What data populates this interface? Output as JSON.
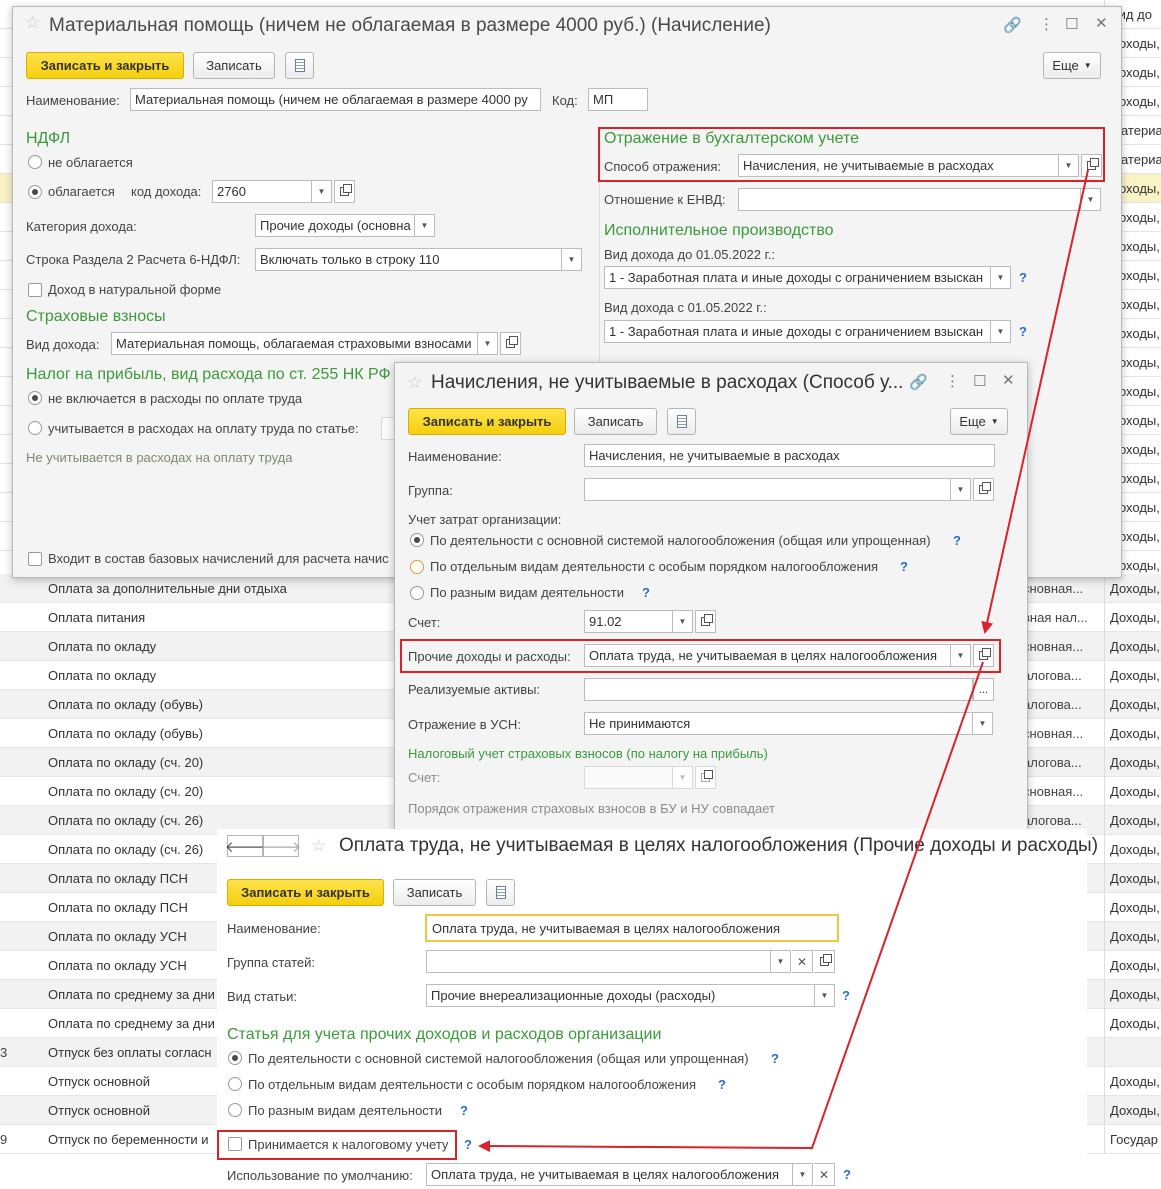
{
  "bg_list": {
    "top_rows": [
      {
        "right": "Вид до"
      },
      {
        "right": "Доходы,"
      },
      {
        "right": "Доходы,"
      },
      {
        "right": "Доходы,"
      },
      {
        "right": "Материа"
      },
      {
        "right": "Материа"
      },
      {
        "right": "Доходы,"
      },
      {
        "right": "Доходы,"
      },
      {
        "right": "Доходы,"
      },
      {
        "right": "Доходы,"
      },
      {
        "right": "Доходы,"
      },
      {
        "right": "Доходы,"
      },
      {
        "right": "Доходы,"
      },
      {
        "right": "Доходы,"
      },
      {
        "right": "Доходы,"
      },
      {
        "right": "Доходы,"
      },
      {
        "right": "Доходы,"
      },
      {
        "right": "Доходы,"
      },
      {
        "right": "Доходы,"
      },
      {
        "right": "Доходы,"
      }
    ],
    "rows": [
      {
        "num": "",
        "name": "Оплата за дополнительные дни отдыха",
        "mid": "сновная...",
        "right": "Доходы,"
      },
      {
        "num": "",
        "name": "Оплата питания",
        "mid": "вная нал...",
        "right": "Доходы,"
      },
      {
        "num": "",
        "name": "Оплата по окладу",
        "mid": "сновная...",
        "right": "Доходы,"
      },
      {
        "num": "",
        "name": "Оплата по окладу",
        "mid": "алогова...",
        "right": "Доходы,"
      },
      {
        "num": "",
        "name": "Оплата по окладу (обувь)",
        "mid": "алогова...",
        "right": "Доходы,"
      },
      {
        "num": "",
        "name": "Оплата по окладу (обувь)",
        "mid": "сновная...",
        "right": "Доходы,"
      },
      {
        "num": "",
        "name": "Оплата по окладу (сч. 20)",
        "mid": "алогова...",
        "right": "Доходы,"
      },
      {
        "num": "",
        "name": "Оплата по окладу (сч. 20)",
        "mid": "сновная...",
        "right": "Доходы,"
      },
      {
        "num": "",
        "name": "Оплата по окладу (сч. 26)",
        "mid": "алогова...",
        "right": "Доходы,"
      },
      {
        "num": "",
        "name": "Оплата по окладу (сч. 26)",
        "mid": "",
        "right": "Доходы,"
      },
      {
        "num": "",
        "name": "Оплата по окладу ПСН",
        "mid": "",
        "right": "Доходы,"
      },
      {
        "num": "",
        "name": "Оплата по окладу ПСН",
        "mid": "",
        "right": "Доходы,"
      },
      {
        "num": "",
        "name": "Оплата по окладу УСН",
        "mid": "",
        "right": "Доходы,"
      },
      {
        "num": "",
        "name": "Оплата по окладу УСН",
        "mid": "",
        "right": "Доходы,"
      },
      {
        "num": "",
        "name": "Оплата по среднему за дни",
        "mid": "",
        "right": "Доходы,"
      },
      {
        "num": "",
        "name": "Оплата по среднему за дни",
        "mid": "",
        "right": "Доходы,"
      },
      {
        "num": "3",
        "name": "Отпуск без оплаты согласн",
        "mid": "",
        "right": ""
      },
      {
        "num": "",
        "name": "Отпуск основной",
        "mid": "",
        "right": "Доходы,"
      },
      {
        "num": "",
        "name": "Отпуск основной",
        "mid": "",
        "right": "Доходы,"
      },
      {
        "num": "9",
        "name": "Отпуск по беременности и",
        "mid": "",
        "right": "Государ"
      }
    ]
  },
  "win1": {
    "title": "Материальная помощь (ничем не облагаемая в размере 4000 руб.) (Начисление)",
    "save_close": "Записать и закрыть",
    "save": "Записать",
    "more": "Еще",
    "name_label": "Наименование:",
    "name_value": "Материальная помощь (ничем не облагаемая в размере 4000 ру",
    "code_label": "Код:",
    "code_value": "МП",
    "ndfl_section": "НДФЛ",
    "not_taxed": "не облагается",
    "taxed": "облагается",
    "income_code_label": "код дохода:",
    "income_code_value": "2760",
    "income_category_label": "Категория дохода:",
    "income_category_value": "Прочие доходы (основна",
    "line_label": "Строка Раздела 2 Расчета 6-НДФЛ:",
    "line_value": "Включать только в строку 110",
    "natural_form": "Доход в натуральной форме",
    "insurance_section": "Страховые взносы",
    "insurance_income_label": "Вид дохода:",
    "insurance_income_value": "Материальная помощь, облагаемая страховыми взносами",
    "profit_tax_section": "Налог на прибыль, вид расхода по ст. 255 НК РФ",
    "not_included": "не включается в расходы по оплате труда",
    "included_by_article": "учитывается в расходах на оплату труда по статье:",
    "not_counted_note": "Не учитывается в расходах на оплату труда",
    "accounting_section": "Отражение в бухгалтерском учете",
    "method_label": "Способ отражения:",
    "method_value": "Начисления, не учитываемые в расходах",
    "envd_label": "Отношение к ЕНВД:",
    "enforcement_section": "Исполнительное производство",
    "income_before_label": "Вид дохода до 01.05.2022 г.:",
    "income_before_value": "1 - Заработная плата и иные доходы с ограничением взыскан",
    "income_after_label": "Вид дохода с 01.05.2022 г.:",
    "income_after_value": "1 - Заработная плата и иные доходы с ограничением взыскан",
    "base_accruals": "Входит в состав базовых начислений для расчета начис"
  },
  "win2": {
    "title": "Начисления, не учитываемые в расходах (Способ у...",
    "save_close": "Записать и закрыть",
    "save": "Записать",
    "more": "Еще",
    "name_label": "Наименование:",
    "name_value": "Начисления, не учитываемые в расходах",
    "group_label": "Группа:",
    "cost_label": "Учет затрат организации:",
    "opt1": "По деятельности с основной системой налогообложения (общая или упрощенная)",
    "opt2": "По отдельным видам деятельности с особым порядком налогообложения",
    "opt3": "По разным видам деятельности",
    "account_label": "Счет:",
    "account_value": "91.02",
    "other_label": "Прочие доходы и расходы:",
    "other_value": "Оплата труда, не учитываемая в целях налогообложения",
    "assets_label": "Реализуемые активы:",
    "usn_label": "Отражение в УСН:",
    "usn_value": "Не принимаются",
    "tax_section": "Налоговый учет страховых взносов (по налогу на прибыль)",
    "tax_account_label": "Счет:",
    "order_note": "Порядок отражения страховых взносов в БУ и НУ совпадает"
  },
  "win3": {
    "title": "Оплата труда, не учитываемая в целях налогообложения (Прочие доходы и расходы)",
    "save_close": "Записать и закрыть",
    "save": "Записать",
    "name_label": "Наименование:",
    "name_value": "Оплата труда, не учитываемая в целях налогообложения",
    "group_label": "Группа статей:",
    "kind_label": "Вид статьи:",
    "kind_value": "Прочие внереализационные доходы (расходы)",
    "section": "Статья для учета прочих доходов и расходов организации",
    "opt1": "По деятельности с основной системой налогообложения (общая или упрощенная)",
    "opt2": "По отдельным видам деятельности с особым порядком налогообложения",
    "opt3": "По разным видам деятельности",
    "accepted": "Принимается к налоговому учету",
    "default_label": "Использование по умолчанию:",
    "default_value": "Оплата труда, не учитываемая в целях налогообложения"
  },
  "q": "?",
  "dots": "...",
  "colors": {
    "accent_green": "#3b9a3b",
    "highlight_red": "#d8232a",
    "button_yellow": "#f5cf0d"
  }
}
